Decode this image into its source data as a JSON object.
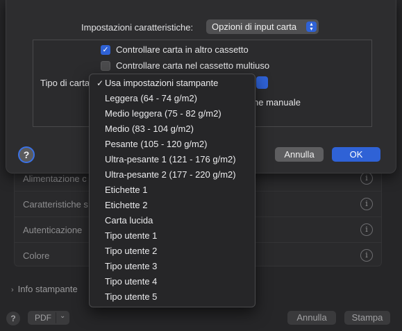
{
  "background": {
    "rows": [
      {
        "label": "Alimentazione c"
      },
      {
        "label": "Caratteristiche s"
      },
      {
        "label": "Autenticazione"
      },
      {
        "label": "Colore"
      }
    ],
    "info_stampante": "Info stampante",
    "help": "?",
    "pdf": "PDF",
    "annulla": "Annulla",
    "stampa": "Stampa"
  },
  "sheet": {
    "feature_label": "Impostazioni caratteristiche:",
    "feature_value": "Opzioni di input carta",
    "check1": "Controllare carta in altro cassetto",
    "check2": "Controllare carta nel cassetto multiuso",
    "tipo_label": "Tipo di carta",
    "manual_text": "ne manuale",
    "help": "?",
    "annulla": "Annulla",
    "ok": "OK"
  },
  "menu": {
    "selected_index": 0,
    "items": [
      "Usa impostazioni stampante",
      "Leggera (64 - 74 g/m2)",
      "Medio leggera (75 - 82 g/m2)",
      "Medio (83 - 104 g/m2)",
      "Pesante (105 - 120 g/m2)",
      "Ultra-pesante 1 (121 - 176 g/m2)",
      "Ultra-pesante 2 (177 - 220 g/m2)",
      "Etichette 1",
      "Etichette 2",
      "Carta lucida",
      "Tipo utente 1",
      "Tipo utente 2",
      "Tipo utente 3",
      "Tipo utente 4",
      "Tipo utente 5"
    ]
  },
  "colors": {
    "accent": "#2f62d6",
    "sheet_bg": "#2d2d2f",
    "menu_bg": "#262628"
  },
  "icons": {
    "checkmark": "checkmark-icon",
    "info": "info-icon",
    "chevron": "chevron-right-icon",
    "stepper": "up-down-chevron-icon"
  }
}
